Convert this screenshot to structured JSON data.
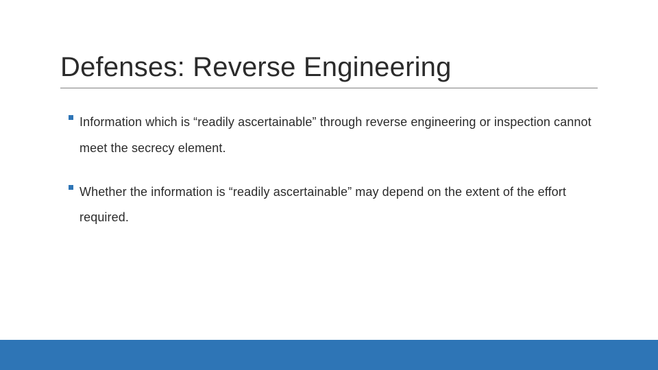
{
  "slide": {
    "title": "Defenses: Reverse Engineering",
    "bullets": [
      "Information which is “readily ascertainable” through reverse engineering or inspection cannot meet the secrecy element.",
      "Whether the information is “readily ascertainable” may depend on the extent of the effort required."
    ]
  },
  "theme": {
    "accent": "#2e75b6",
    "underline": "#808080",
    "text": "#2b2b2b"
  }
}
